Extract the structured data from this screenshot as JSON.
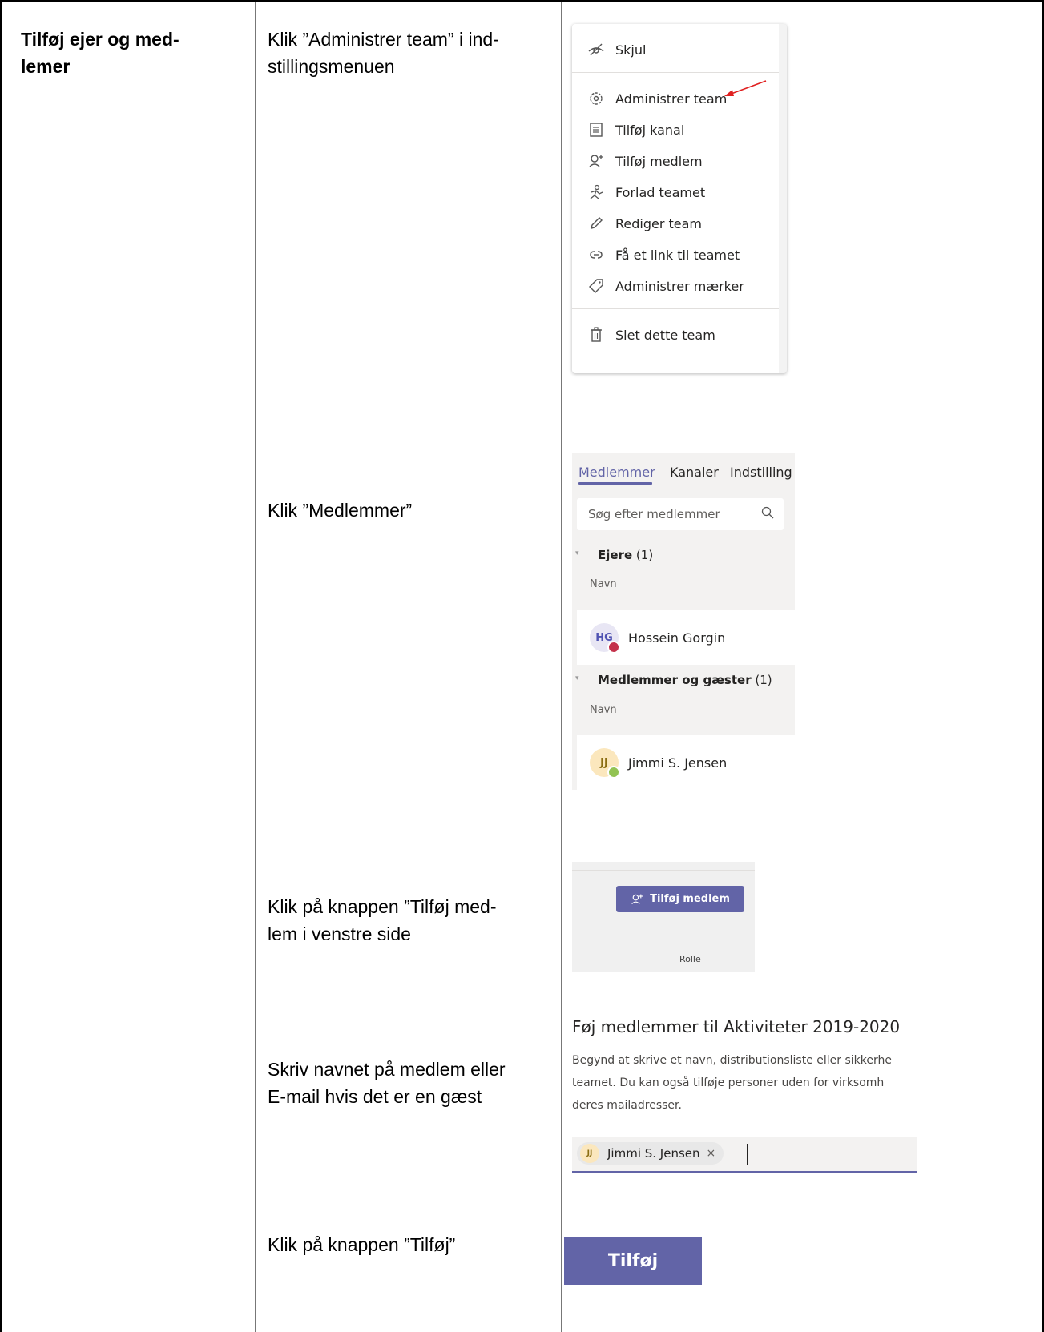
{
  "table": {
    "heading": "Tilføj ejer og med-lemer",
    "heading_line1": "Tilføj ejer og med-",
    "heading_line2": "lemer"
  },
  "steps": [
    {
      "line1": "Klik ”Administrer team” i ind-",
      "line2": "stillingsmenuen"
    },
    {
      "line1": "Klik ”Medlemmer”"
    },
    {
      "line1": "Klik på knappen ”Tilføj med-",
      "line2": "lem i venstre side"
    },
    {
      "line1": "Skriv navnet på medlem eller",
      "line2": "E-mail hvis det er en gæst"
    },
    {
      "line1": "Klik på knappen ”Tilføj”"
    }
  ],
  "settings_menu": {
    "items": [
      {
        "label": "Skjul",
        "icon": "hide-eye-slash-icon"
      },
      {
        "label": "Administrer team",
        "icon": "gear-icon"
      },
      {
        "label": "Tilføj kanal",
        "icon": "channel-list-icon"
      },
      {
        "label": "Tilføj medlem",
        "icon": "add-person-icon"
      },
      {
        "label": "Forlad teamet",
        "icon": "leave-team-icon"
      },
      {
        "label": "Rediger team",
        "icon": "pencil-icon"
      },
      {
        "label": "Få et link til teamet",
        "icon": "link-icon"
      },
      {
        "label": "Administrer mærker",
        "icon": "tag-icon"
      },
      {
        "label": "Slet dette team",
        "icon": "trash-icon"
      }
    ],
    "annotation": "red-arrow-pointer"
  },
  "members_panel": {
    "tabs": [
      "Medlemmer",
      "Kanaler",
      "Indstilling"
    ],
    "active_tab": "Medlemmer",
    "search_placeholder": "Søg efter medlemmer",
    "owners": {
      "title": "Ejere",
      "count": "(1)",
      "column": "Navn"
    },
    "owner_member": {
      "initials": "HG",
      "name": "Hossein Gorgin",
      "presence_color": "#c4314b"
    },
    "guests": {
      "title": "Medlemmer og gæster",
      "count": "(1)",
      "column": "Navn"
    },
    "guest_member": {
      "initials": "JJ",
      "name": "Jimmi S. Jensen",
      "presence_color": "#92c353"
    }
  },
  "add_member_button": {
    "label": "Tilføj medlem",
    "icon": "add-person-icon",
    "column_label": "Rolle"
  },
  "add_dialog": {
    "title": "Føj medlemmer til Aktiviteter 2019-2020",
    "desc_line1": "Begynd at skrive et navn, distributionsliste eller sikkerhe",
    "desc_line2": "teamet. Du kan også tilføje personer uden for virksomh",
    "desc_line3": "deres mailadresser.",
    "chip_initials": "JJ",
    "chip_name": "Jimmi S. Jensen"
  },
  "final_button": {
    "label": "Tilføj"
  },
  "colors": {
    "accent": "#6264a7",
    "annotation": "#e02020"
  }
}
